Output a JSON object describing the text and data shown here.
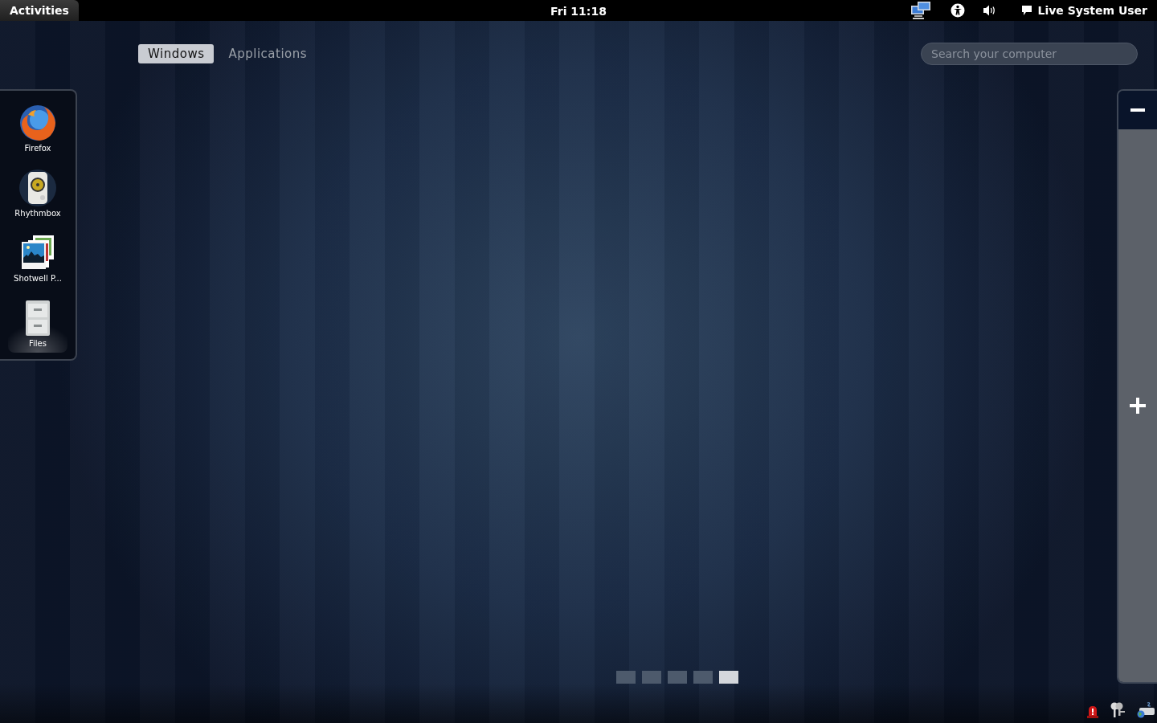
{
  "top_bar": {
    "activities": "Activities",
    "clock": "Fri 11:18",
    "user": "Live System User"
  },
  "view_tabs": [
    {
      "label": "Windows",
      "selected": true
    },
    {
      "label": "Applications",
      "selected": false
    }
  ],
  "search": {
    "placeholder": "Search your computer"
  },
  "dash": [
    {
      "label": "Firefox",
      "kind": "firefox",
      "running": false
    },
    {
      "label": "Rhythmbox",
      "kind": "rhythmbox",
      "running": false
    },
    {
      "label": "Shotwell P...",
      "kind": "shotwell",
      "running": false
    },
    {
      "label": "Files",
      "kind": "files",
      "running": true
    }
  ],
  "workspaces": [
    {
      "selected": false
    },
    {
      "selected": false
    },
    {
      "selected": false
    },
    {
      "selected": false
    },
    {
      "selected": true
    }
  ]
}
